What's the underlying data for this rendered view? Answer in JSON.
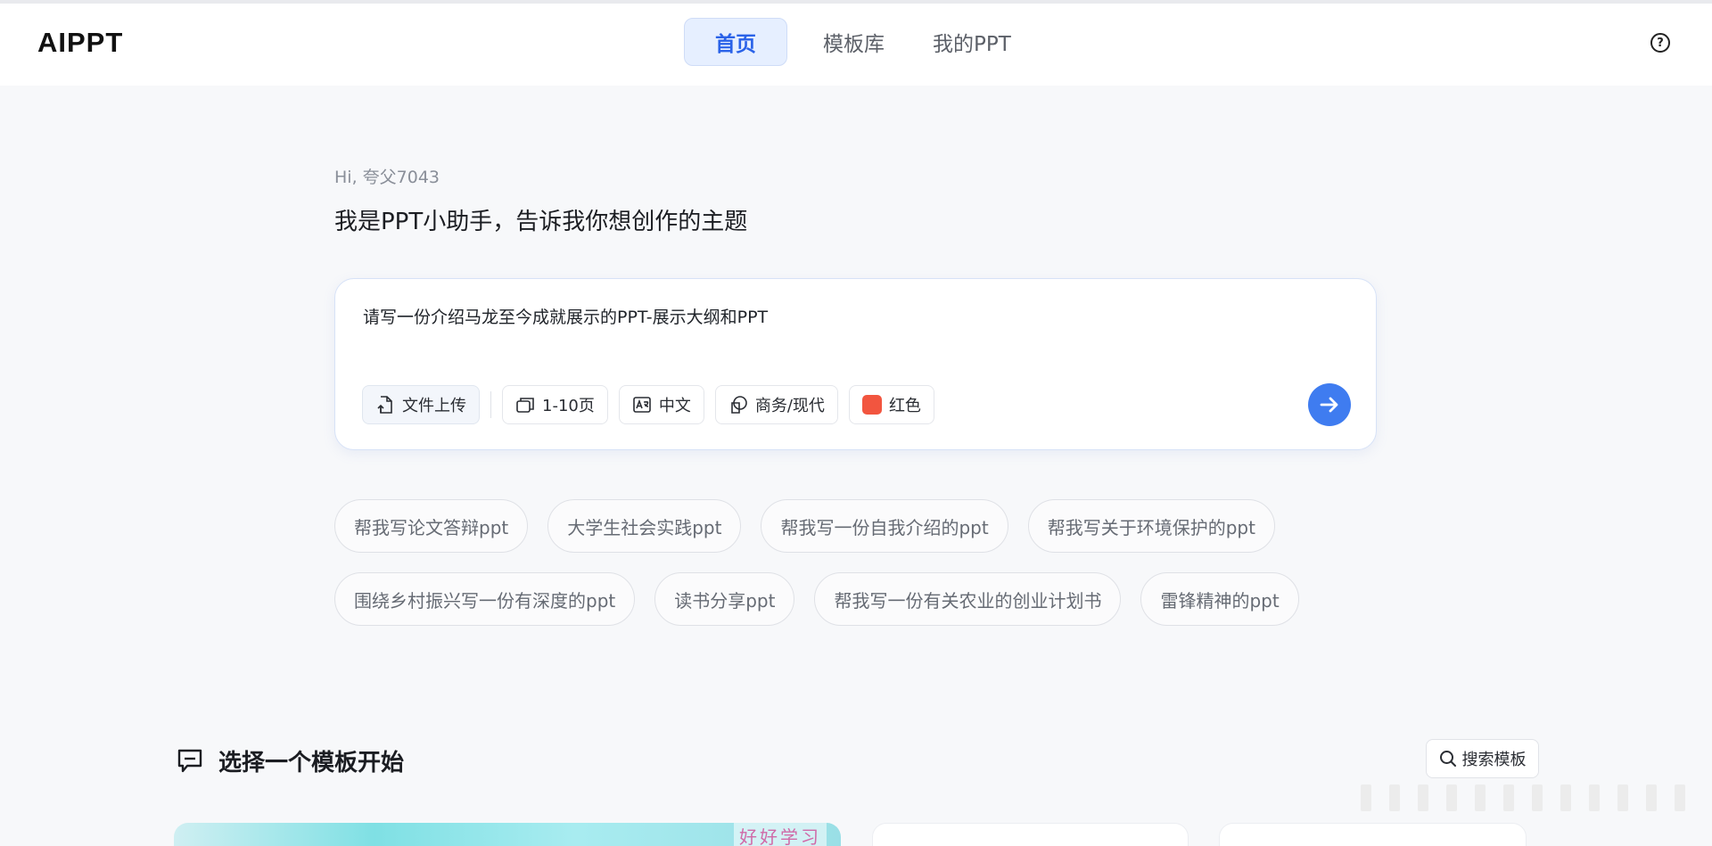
{
  "header": {
    "logo": "AIPPT",
    "nav": [
      {
        "label": "首页",
        "active": true
      },
      {
        "label": "模板库",
        "active": false
      },
      {
        "label": "我的PPT",
        "active": false
      }
    ],
    "help_icon": "question-circle-icon"
  },
  "hero": {
    "greeting": "Hi, 夸父7043",
    "headline": "我是PPT小助手，告诉我你想创作的主题"
  },
  "composer": {
    "prompt_value": "请写一份介绍马龙至今成就展示的PPT-展示大纲和PPT",
    "options": {
      "upload": "文件上传",
      "pages": "1-10页",
      "language": "中文",
      "style": "商务/现代",
      "color": "红色"
    },
    "color_value": "#f2553f",
    "accent": "#3f7cf0"
  },
  "suggestions": {
    "row1": [
      "帮我写论文答辩ppt",
      "大学生社会实践ppt",
      "帮我写一份自我介绍的ppt",
      "帮我写关于环境保护的ppt"
    ],
    "row2": [
      "围绕乡村振兴写一份有深度的ppt",
      "读书分享ppt",
      "帮我写一份有关农业的创业计划书",
      "雷锋精神的ppt"
    ]
  },
  "templates": {
    "title": "选择一个模板开始",
    "search_label": "搜索模板",
    "card1_text": "好好学习"
  }
}
